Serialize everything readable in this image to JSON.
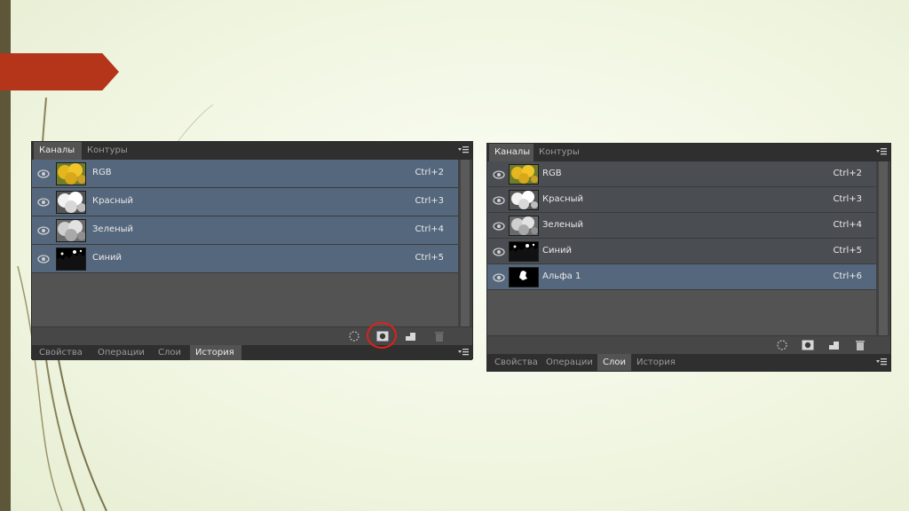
{
  "colors": {
    "accent_arrow": "#b5351a",
    "selected_row": "#55677d",
    "panel_bg": "#535353",
    "annotation_circle": "#e0201a"
  },
  "panel_left": {
    "tabs": [
      {
        "label": "Каналы",
        "active": true
      },
      {
        "label": "Контуры",
        "active": false
      }
    ],
    "channels": [
      {
        "name": "RGB",
        "shortcut": "Ctrl+2",
        "thumb": "rgb-thumbnail"
      },
      {
        "name": "Красный",
        "shortcut": "Ctrl+3",
        "thumb": "red-thumbnail"
      },
      {
        "name": "Зеленый",
        "shortcut": "Ctrl+4",
        "thumb": "green-thumbnail"
      },
      {
        "name": "Синий",
        "shortcut": "Ctrl+5",
        "thumb": "blue-thumbnail"
      }
    ],
    "footer_icons": [
      "load-selection-icon",
      "save-selection-as-channel-icon",
      "new-channel-icon",
      "delete-channel-icon"
    ],
    "bottom_tabs": [
      {
        "label": "Свойства",
        "active": false
      },
      {
        "label": "Операции",
        "active": false
      },
      {
        "label": "Слои",
        "active": false
      },
      {
        "label": "История",
        "active": true
      }
    ]
  },
  "panel_right": {
    "tabs": [
      {
        "label": "Каналы",
        "active": true
      },
      {
        "label": "Контуры",
        "active": false
      }
    ],
    "channels": [
      {
        "name": "RGB",
        "shortcut": "Ctrl+2",
        "thumb": "rgb-thumbnail"
      },
      {
        "name": "Красный",
        "shortcut": "Ctrl+3",
        "thumb": "red-thumbnail"
      },
      {
        "name": "Зеленый",
        "shortcut": "Ctrl+4",
        "thumb": "green-thumbnail"
      },
      {
        "name": "Синий",
        "shortcut": "Ctrl+5",
        "thumb": "blue-thumbnail"
      },
      {
        "name": "Альфа 1",
        "shortcut": "Ctrl+6",
        "thumb": "alpha-thumbnail"
      }
    ],
    "footer_icons": [
      "load-selection-icon",
      "save-selection-as-channel-icon",
      "new-channel-icon",
      "delete-channel-icon"
    ],
    "bottom_tabs": [
      {
        "label": "Свойства",
        "active": false
      },
      {
        "label": "Операции",
        "active": false
      },
      {
        "label": "Слои",
        "active": true
      },
      {
        "label": "История",
        "active": false
      }
    ]
  }
}
